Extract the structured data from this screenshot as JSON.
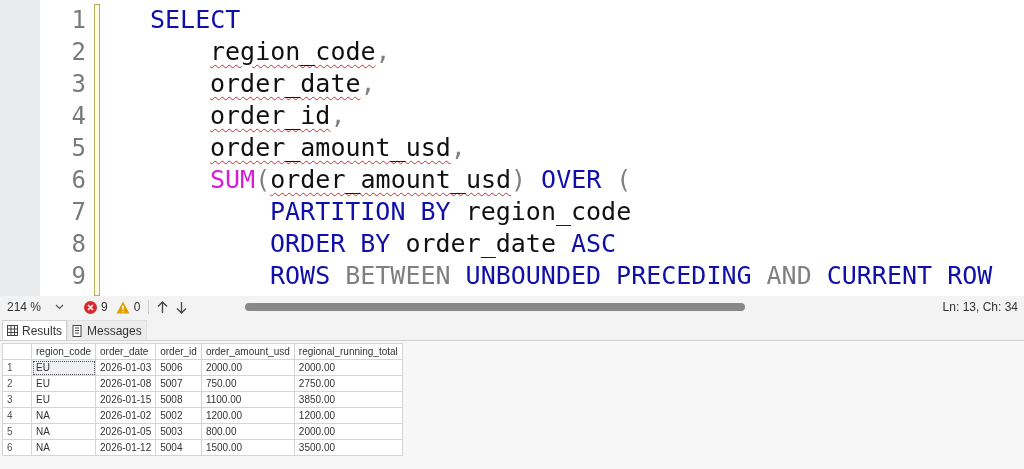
{
  "editor": {
    "lines": [
      {
        "number": "1",
        "words": [
          {
            "tokens": [
              {
                "kind": "keyword",
                "text": "SELECT",
                "error": false
              }
            ]
          }
        ],
        "children": [
          {
            "number": "2",
            "words": [
              {
                "tokens": [
                  {
                    "kind": "identifier",
                    "text": "region_code",
                    "error": true
                  },
                  {
                    "kind": "punct",
                    "text": ",",
                    "error": false
                  }
                ]
              }
            ]
          },
          {
            "number": "3",
            "words": [
              {
                "tokens": [
                  {
                    "kind": "identifier",
                    "text": "order_date",
                    "error": true
                  },
                  {
                    "kind": "punct",
                    "text": ",",
                    "error": false
                  }
                ]
              }
            ]
          },
          {
            "number": "4",
            "words": [
              {
                "tokens": [
                  {
                    "kind": "identifier",
                    "text": "order_id",
                    "error": true
                  },
                  {
                    "kind": "punct",
                    "text": ",",
                    "error": false
                  }
                ]
              }
            ]
          },
          {
            "number": "5",
            "words": [
              {
                "tokens": [
                  {
                    "kind": "identifier",
                    "text": "order_amount_usd",
                    "error": true
                  },
                  {
                    "kind": "punct",
                    "text": ",",
                    "error": false
                  }
                ]
              }
            ]
          },
          {
            "number": "6",
            "words": [
              {
                "tokens": [
                  {
                    "kind": "function",
                    "text": "SUM",
                    "error": false
                  },
                  {
                    "kind": "punct",
                    "text": "(",
                    "error": false
                  },
                  {
                    "kind": "identifier",
                    "text": "order_amount_usd",
                    "error": true
                  },
                  {
                    "kind": "punct",
                    "text": ")",
                    "error": false
                  }
                ]
              },
              {
                "tokens": [
                  {
                    "kind": "keyword",
                    "text": "OVER",
                    "error": false
                  }
                ]
              },
              {
                "tokens": [
                  {
                    "kind": "punct",
                    "text": "(",
                    "error": false
                  }
                ]
              }
            ],
            "children": [
              {
                "number": "7",
                "words": [
                  {
                    "tokens": [
                      {
                        "kind": "keyword",
                        "text": "PARTITION BY",
                        "error": false
                      }
                    ]
                  },
                  {
                    "tokens": [
                      {
                        "kind": "identifier",
                        "text": "region_code",
                        "error": false
                      }
                    ]
                  }
                ]
              },
              {
                "number": "8",
                "words": [
                  {
                    "tokens": [
                      {
                        "kind": "keyword",
                        "text": "ORDER BY",
                        "error": false
                      }
                    ]
                  },
                  {
                    "tokens": [
                      {
                        "kind": "identifier",
                        "text": "order_date",
                        "error": false
                      }
                    ]
                  },
                  {
                    "tokens": [
                      {
                        "kind": "keyword",
                        "text": "ASC",
                        "error": false
                      }
                    ]
                  }
                ]
              },
              {
                "number": "9",
                "words": [
                  {
                    "tokens": [
                      {
                        "kind": "keyword",
                        "text": "ROWS",
                        "error": false
                      }
                    ]
                  },
                  {
                    "tokens": [
                      {
                        "kind": "punct",
                        "text": "BETWEEN",
                        "error": false
                      }
                    ]
                  },
                  {
                    "tokens": [
                      {
                        "kind": "keyword",
                        "text": "UNBOUNDED PRECEDING",
                        "error": false
                      }
                    ]
                  },
                  {
                    "tokens": [
                      {
                        "kind": "punct",
                        "text": "AND",
                        "error": false
                      }
                    ]
                  },
                  {
                    "tokens": [
                      {
                        "kind": "keyword",
                        "text": "CURRENT ROW",
                        "error": false
                      }
                    ]
                  }
                ]
              }
            ]
          }
        ]
      }
    ]
  },
  "status_bar": {
    "zoom": "214 %",
    "errors": "9",
    "warnings": "0",
    "position": "Ln: 13, Ch: 34"
  },
  "tabs": [
    {
      "label": "Results",
      "selected": true
    },
    {
      "label": "Messages",
      "selected": false
    }
  ],
  "table": {
    "columns": [
      "region_code",
      "order_date",
      "order_id",
      "order_amount_usd",
      "regional_running_total"
    ],
    "rows": [
      {
        "number": "1",
        "cells": [
          {
            "text": "EU",
            "focused": true
          },
          {
            "text": "2026-01-03",
            "focused": false
          },
          {
            "text": "5006",
            "focused": false
          },
          {
            "text": "2000.00",
            "focused": false
          },
          {
            "text": "2000.00",
            "focused": false
          }
        ]
      },
      {
        "number": "2",
        "cells": [
          {
            "text": "EU",
            "focused": false
          },
          {
            "text": "2026-01-08",
            "focused": false
          },
          {
            "text": "5007",
            "focused": false
          },
          {
            "text": "750.00",
            "focused": false
          },
          {
            "text": "2750.00",
            "focused": false
          }
        ]
      },
      {
        "number": "3",
        "cells": [
          {
            "text": "EU",
            "focused": false
          },
          {
            "text": "2026-01-15",
            "focused": false
          },
          {
            "text": "5008",
            "focused": false
          },
          {
            "text": "1100.00",
            "focused": false
          },
          {
            "text": "3850.00",
            "focused": false
          }
        ]
      },
      {
        "number": "4",
        "cells": [
          {
            "text": "NA",
            "focused": false
          },
          {
            "text": "2026-01-02",
            "focused": false
          },
          {
            "text": "5002",
            "focused": false
          },
          {
            "text": "1200.00",
            "focused": false
          },
          {
            "text": "1200.00",
            "focused": false
          }
        ]
      },
      {
        "number": "5",
        "cells": [
          {
            "text": "NA",
            "focused": false
          },
          {
            "text": "2026-01-05",
            "focused": false
          },
          {
            "text": "5003",
            "focused": false
          },
          {
            "text": "800.00",
            "focused": false
          },
          {
            "text": "2000.00",
            "focused": false
          }
        ]
      },
      {
        "number": "6",
        "cells": [
          {
            "text": "NA",
            "focused": false
          },
          {
            "text": "2026-01-12",
            "focused": false
          },
          {
            "text": "5004",
            "focused": false
          },
          {
            "text": "1500.00",
            "focused": false
          },
          {
            "text": "3500.00",
            "focused": false
          }
        ]
      }
    ]
  }
}
